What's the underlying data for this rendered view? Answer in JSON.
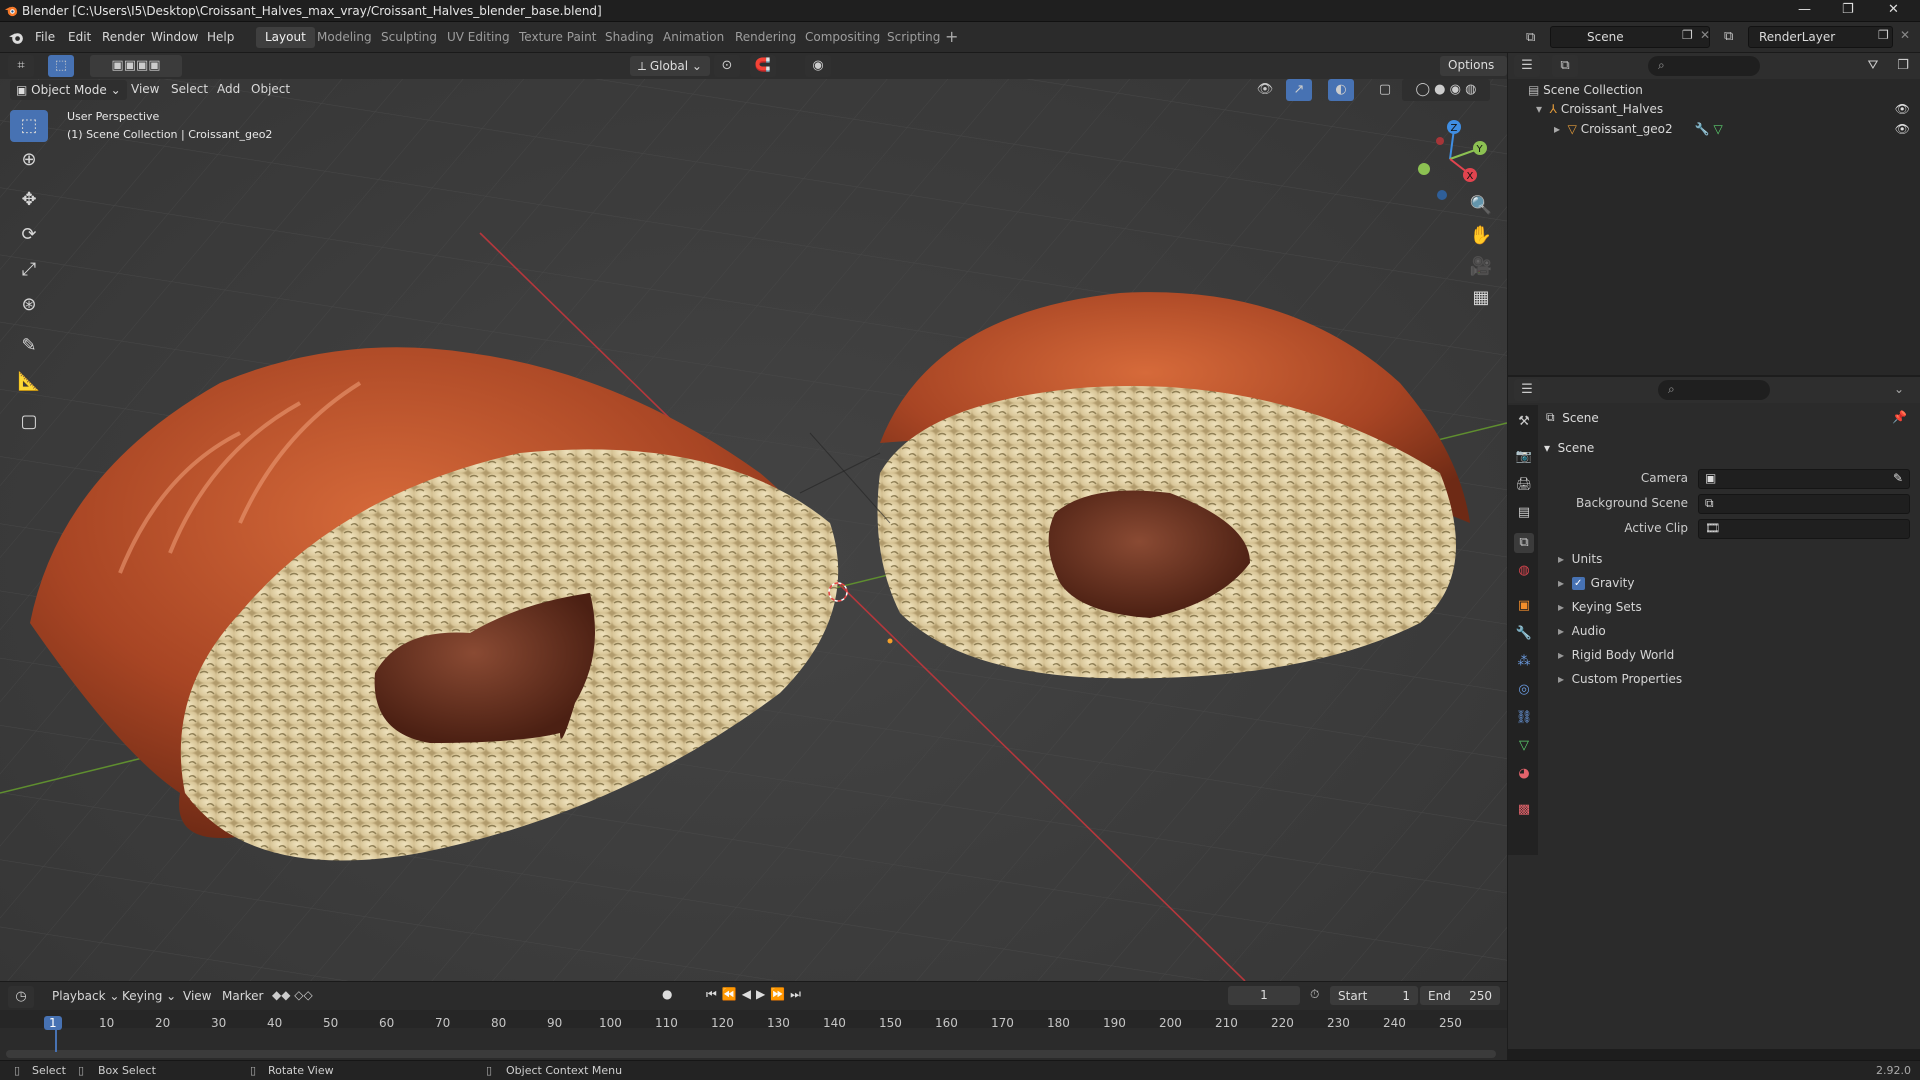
{
  "window": {
    "title": "Blender [C:\\Users\\I5\\Desktop\\Croissant_Halves_max_vray/Croissant_Halves_blender_base.blend]",
    "controls": [
      "—",
      "❐",
      "✕"
    ]
  },
  "menus": [
    "File",
    "Edit",
    "Render",
    "Window",
    "Help"
  ],
  "workspaces": [
    "Layout",
    "Modeling",
    "Sculpting",
    "UV Editing",
    "Texture Paint",
    "Shading",
    "Animation",
    "Rendering",
    "Compositing",
    "Scripting"
  ],
  "active_workspace": "Layout",
  "scene_field": "Scene",
  "renderlayer_field": "RenderLayer",
  "viewport": {
    "mode": "Object Mode",
    "menus": [
      "View",
      "Select",
      "Add",
      "Object"
    ],
    "transform_orientation": "Global",
    "options_label": "Options",
    "perspective": "User Perspective",
    "collection_info": "(1) Scene Collection | Croissant_geo2",
    "gizmo_axes": [
      "Z",
      "Y",
      "X"
    ]
  },
  "outliner": {
    "root": "Scene Collection",
    "items": [
      {
        "label": "Croissant_Halves",
        "level": 1
      },
      {
        "label": "Croissant_geo2",
        "level": 2
      }
    ]
  },
  "properties": {
    "context": "Scene",
    "panel": "Scene",
    "fields": [
      {
        "label": "Camera"
      },
      {
        "label": "Background Scene"
      },
      {
        "label": "Active Clip"
      }
    ],
    "sections": [
      "Units",
      "Gravity",
      "Keying Sets",
      "Audio",
      "Rigid Body World",
      "Custom Properties"
    ],
    "gravity_checked": true
  },
  "timeline": {
    "menus": [
      "Playback",
      "Keying",
      "View",
      "Marker"
    ],
    "current_frame": "1",
    "start_label": "Start",
    "start": "1",
    "end_label": "End",
    "end": "250",
    "ruler": [
      "1",
      "10",
      "20",
      "30",
      "40",
      "50",
      "60",
      "70",
      "80",
      "90",
      "100",
      "110",
      "120",
      "130",
      "140",
      "150",
      "160",
      "170",
      "180",
      "190",
      "200",
      "210",
      "220",
      "230",
      "240",
      "250"
    ]
  },
  "statusbar": {
    "select": "Select",
    "box_select": "Box Select",
    "rotate": "Rotate View",
    "context_menu": "Object Context Menu",
    "version": "2.92.0"
  },
  "colors": {
    "accent": "#4772b3",
    "x_axis": "#e2444f",
    "y_axis": "#8cc152",
    "z_axis": "#3f8ee3",
    "crust": "#b9532c",
    "crumb": "#e8d8ae",
    "chocolate": "#6b3220"
  }
}
